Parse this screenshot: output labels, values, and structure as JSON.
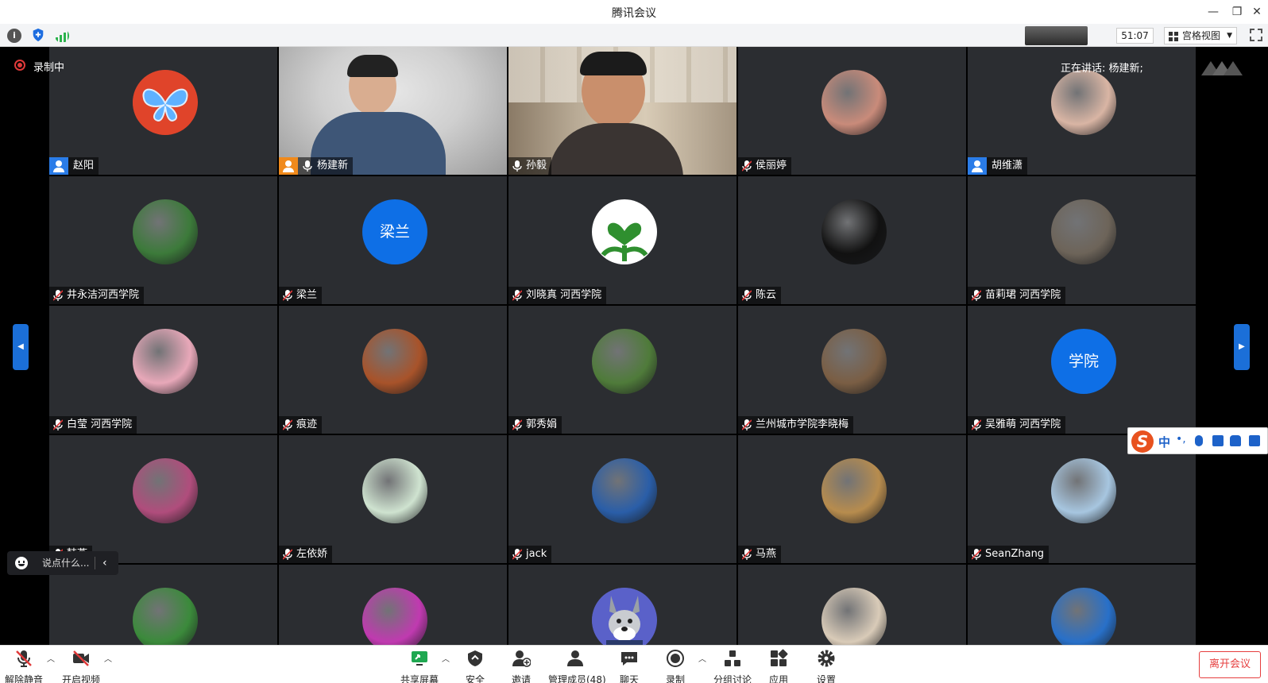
{
  "window": {
    "title": "腾讯会议"
  },
  "topbar": {
    "timer": "51:07",
    "view_label": "宫格视图"
  },
  "status": {
    "recording": "录制中",
    "speaking": "正在讲话: 杨建新;"
  },
  "chat": {
    "placeholder": "说点什么..."
  },
  "ime": {
    "mode": "中"
  },
  "participants": [
    {
      "name": "赵阳",
      "avatar": "butterfly-avatar",
      "host": true,
      "color": "#e0442a"
    },
    {
      "name": "杨建新",
      "avatar": "camera-video",
      "cohost": true,
      "active": true
    },
    {
      "name": "孙毅",
      "avatar": "camera-video"
    },
    {
      "name": "侯丽婷",
      "avatar": "photo-avatar",
      "color": "#c98b7a"
    },
    {
      "name": "胡维潇",
      "avatar": "baby-avatar",
      "host": true,
      "color": "#d9b5a4"
    },
    {
      "name": "井永洁河西学院",
      "avatar": "photo-avatar",
      "color": "#3c7a3a"
    },
    {
      "name": "梁兰",
      "avatar_text": "梁兰"
    },
    {
      "name": "刘晓真 河西学院",
      "avatar": "heart-plant-avatar",
      "color": "#ffffff"
    },
    {
      "name": "陈云",
      "avatar": "astronaut-avatar",
      "color": "#111111"
    },
    {
      "name": "苗莉珺  河西学院",
      "avatar": "street-avatar",
      "color": "#6d6459"
    },
    {
      "name": "白莹 河西学院",
      "avatar": "child-avatar",
      "color": "#e8a8b9"
    },
    {
      "name": "痕迹",
      "avatar": "bear-avatar",
      "color": "#a8532a"
    },
    {
      "name": "郭秀娟",
      "avatar": "garden-avatar",
      "color": "#4f7b3a"
    },
    {
      "name": "兰州城市学院李晓梅",
      "avatar": "group-photo-avatar",
      "color": "#7a5e44"
    },
    {
      "name": "吴雅萌  河西学院",
      "avatar_text": "学院"
    },
    {
      "name": "韩燕",
      "avatar": "stairs-avatar",
      "color": "#b04d7c"
    },
    {
      "name": "左依娇",
      "avatar": "dress-avatar",
      "color": "#cfe3d0"
    },
    {
      "name": "jack",
      "avatar": "buildings-avatar",
      "color": "#2a5ea8"
    },
    {
      "name": "马燕",
      "avatar": "painting-avatar",
      "color": "#b78c4e"
    },
    {
      "name": "SeanZhang",
      "avatar": "snow-avatar",
      "color": "#a7c6e0"
    },
    {
      "name": "",
      "avatar": "leaves-avatar",
      "color": "#3b8a3b"
    },
    {
      "name": "",
      "avatar": "pink-tree-avatar",
      "color": "#c03ab0"
    },
    {
      "name": "",
      "avatar": "cartoon-dog-avatar",
      "color": "#6366c7"
    },
    {
      "name": "",
      "avatar": "sketch-avatar",
      "color": "#d9cbb8"
    },
    {
      "name": "",
      "avatar": "mountain-avatar",
      "color": "#2870c9"
    }
  ],
  "toolbar": {
    "unmute": "解除静音",
    "video": "开启视频",
    "share": "共享屏幕",
    "security": "安全",
    "invite": "邀请",
    "members": "管理成员(48)",
    "chat": "聊天",
    "record": "录制",
    "breakout": "分组讨论",
    "apps": "应用",
    "settings": "设置",
    "leave": "离开会议"
  }
}
